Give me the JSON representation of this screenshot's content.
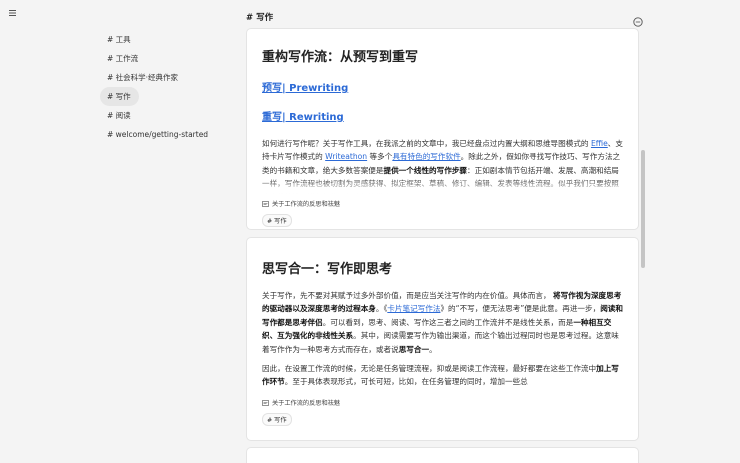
{
  "header": {
    "title": "# 写作"
  },
  "sidebar": {
    "items": [
      {
        "label": "# 工具"
      },
      {
        "label": "# 工作流"
      },
      {
        "label": "# 社会科学·经典作家"
      },
      {
        "label": "# 写作",
        "active": true
      },
      {
        "label": "# 阅读"
      },
      {
        "label": "# welcome/getting-started"
      }
    ]
  },
  "notes": [
    {
      "title": "重构写作流：从预写到重写",
      "links": [
        "预写| Prewriting",
        "重写| Rewriting"
      ],
      "p1_a": "如何进行写作呢？关于写作工具，在我派之前的文章中，我已经盘点过内置大纲和思维导图模式的 ",
      "p1_link1": "Effie",
      "p1_b": "、支持卡片写作模式的 ",
      "p1_link2": "Writeathon",
      "p1_c": " 等多个",
      "p1_link3": "具有特色的写作软件",
      "p1_d": "。除此之外，假如你寻找写作技巧、写作方法之类的书籍和文章，绝大多数答案便是",
      "p1_bold": "提供一个线性的写作步骤",
      "p1_e": "：正如剧本情节包括开端、发展、高潮和结局一样，写作流程也被切割为灵感获得、拟定框架、草稿、修订、编辑、发表等线性流程。似乎我们只要按照这个线性流程进行操作，便会很快学会",
      "ref": "关于工作流的反思和祛魅",
      "tag": "# 写作"
    },
    {
      "title": "思写合一：写作即思考",
      "p1_a": "关于写作，先不要对其赋予过多外部价值，而是应当关注写作的内在价值。具体而言， ",
      "p1_bold1": "将写作视为深度思考的驱动器以及深度思考的过程本身",
      "p1_b": "。《",
      "p1_link": "卡片笔记写作法",
      "p1_c": "》的“不写，便无法思考”便是此意。再进一步，",
      "p1_bold2": "阅读和写作都是思考伴侣",
      "p1_d": "。可以看到，思考、阅读、写作这三者之间的工作流并不是线性关系，而是",
      "p1_bold3": "一种相互交织、互为强化的非线性关系",
      "p1_e": "。其中，阅读需要写作为输出渠道，而这个输出过程同时也是思考过程。这意味着写作作为一种思考方式而存在，或者说",
      "p1_bold4": "思写合一",
      "p1_f": "。",
      "p2_a": "因此，在设置工作流的时候，无论是任务管理流程，抑或是阅读工作流程，最好都要在这些工作流中",
      "p2_bold": "加上写作环节",
      "p2_b": "。至于具体表现形式，可长可短，比如，在任务管理的同时，增加一些总",
      "ref": "关于工作流的反思和祛魅",
      "tag": "# 写作"
    }
  ]
}
